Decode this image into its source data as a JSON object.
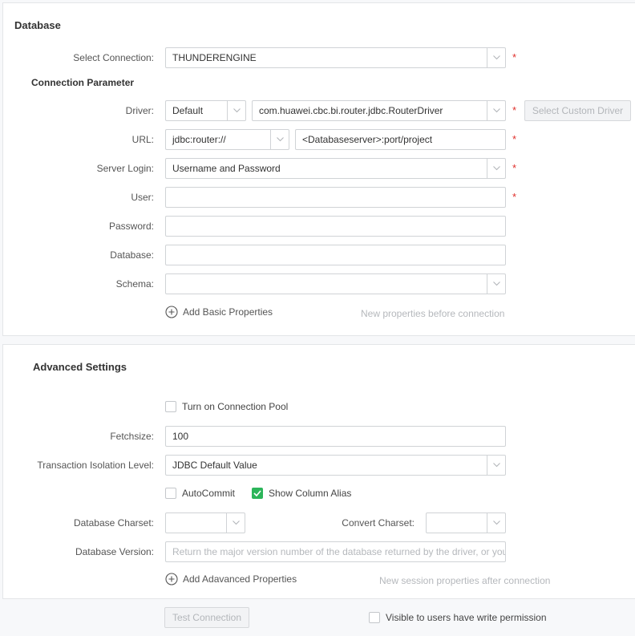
{
  "database": {
    "title": "Database",
    "select_connection": {
      "label": "Select Connection:",
      "value": "THUNDERENGINE",
      "required": true
    },
    "connection_parameter_title": "Connection Parameter",
    "driver": {
      "label": "Driver:",
      "type_value": "Default",
      "class_value": "com.huawei.cbc.bi.router.jdbc.RouterDriver",
      "required": true,
      "custom_button": "Select Custom Driver"
    },
    "url": {
      "label": "URL:",
      "prefix_value": "jdbc:router://",
      "value": "<Databaseserver>:port/project",
      "required": true
    },
    "server_login": {
      "label": "Server Login:",
      "value": "Username and Password",
      "required": true
    },
    "user": {
      "label": "User:",
      "value": "",
      "required": true
    },
    "password": {
      "label": "Password:",
      "value": ""
    },
    "database_field": {
      "label": "Database:",
      "value": ""
    },
    "schema": {
      "label": "Schema:",
      "value": ""
    },
    "add_basic": {
      "label": "Add Basic Properties",
      "icon": "plus-circle-icon",
      "hint": "New properties before connection"
    }
  },
  "advanced": {
    "title": "Advanced Settings",
    "connection_pool": {
      "label": "Turn on Connection Pool",
      "checked": false
    },
    "fetchsize": {
      "label": "Fetchsize:",
      "value": "100"
    },
    "isolation": {
      "label": "Transaction Isolation Level:",
      "value": "JDBC Default Value"
    },
    "autocommit": {
      "label": "AutoCommit",
      "checked": false
    },
    "show_alias": {
      "label": "Show Column Alias",
      "checked": true
    },
    "db_charset": {
      "label": "Database Charset:",
      "value": ""
    },
    "convert_charset": {
      "label": "Convert Charset:",
      "value": ""
    },
    "db_version": {
      "label": "Database Version:",
      "placeholder": "Return the major version number of the database returned by the driver, or you"
    },
    "add_advanced": {
      "label": "Add Adavanced Properties",
      "icon": "plus-circle-icon",
      "hint": "New session properties after connection"
    }
  },
  "footer": {
    "test_connection": "Test Connection",
    "visible_write": {
      "label": "Visible to users have write permission",
      "checked": false
    }
  },
  "colors": {
    "required": "#e0302c",
    "checkbox_checked": "#2cb55a",
    "disabled_text": "#b3b6ba"
  },
  "required_mark": "*"
}
